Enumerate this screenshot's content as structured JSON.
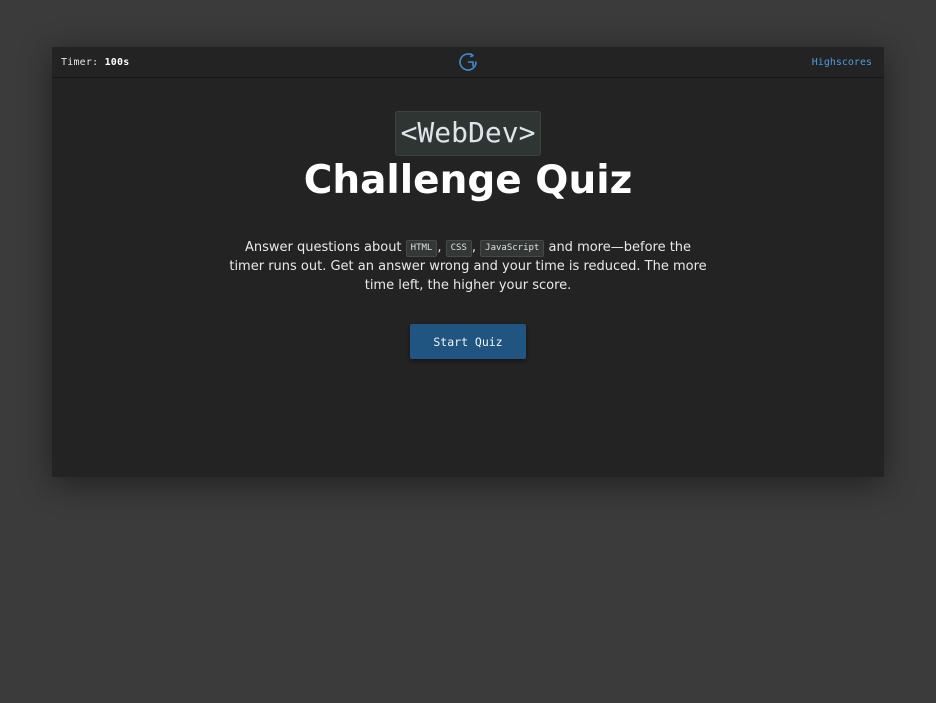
{
  "header": {
    "timer_label": "Timer:",
    "timer_value": "100s",
    "logo_icon": "refresh-g-logo-icon",
    "highscores_label": "Highscores",
    "accent_color": "#4a9be0"
  },
  "hero": {
    "brand": "<WebDev>",
    "title": "Challenge Quiz"
  },
  "description": {
    "part1": "Answer questions about ",
    "code1": "HTML",
    "sep1": ", ",
    "code2": "CSS",
    "sep2": ", ",
    "code3": "JavaScript",
    "part2": " and more—before the timer runs out. Get an answer wrong and your time is reduced. The more time left, the higher your score."
  },
  "start_button": {
    "label": "Start Quiz",
    "color": "#1f5580"
  }
}
